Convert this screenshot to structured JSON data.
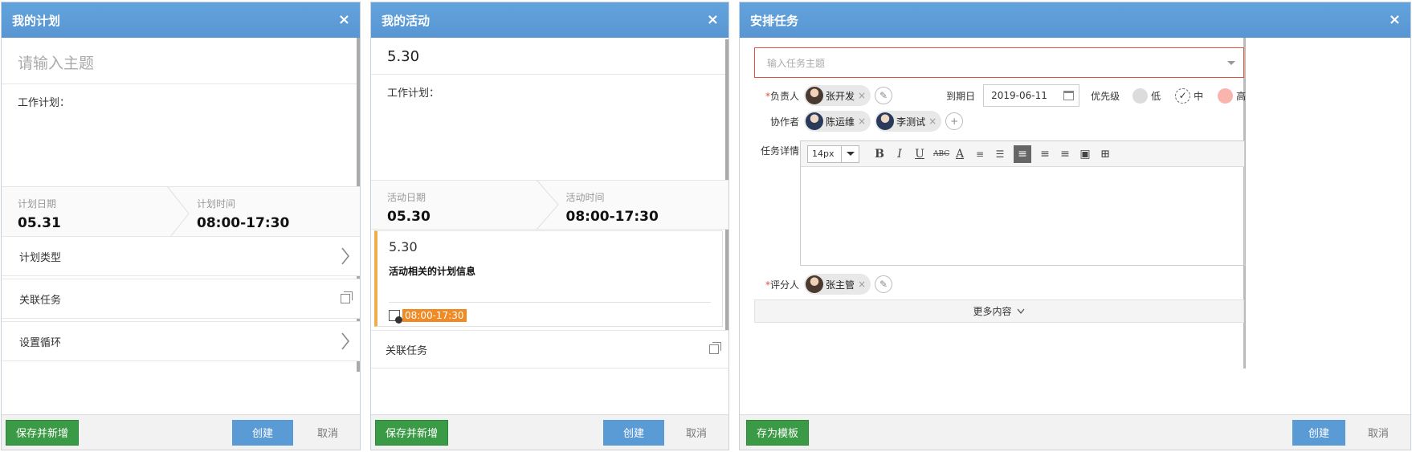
{
  "panel1": {
    "title": "我的计划",
    "close": "×",
    "subject_placeholder": "请输入主题",
    "body_label": "工作计划：",
    "date_label": "计划日期",
    "date_value": "05.31",
    "time_label": "计划时间",
    "time_value": "08:00-17:30",
    "rows": [
      "计划类型",
      "关联任务",
      "设置循环"
    ],
    "save_new": "保存并新增",
    "create": "创建",
    "cancel": "取消"
  },
  "panel2": {
    "title": "我的活动",
    "close": "×",
    "subject": "5.30",
    "body_label": "工作计划：",
    "date_label": "活动日期",
    "date_value": "05.30",
    "time_label": "活动时间",
    "time_value": "08:00-17:30",
    "card_title": "5.30",
    "card_desc": "活动相关的计划信息",
    "card_time": "08:00-17:30",
    "related": "关联任务",
    "save_new": "保存并新增",
    "create": "创建",
    "cancel": "取消"
  },
  "panel3": {
    "title": "安排任务",
    "close": "×",
    "subject_placeholder": "输入任务主题",
    "owner_label": "负责人",
    "owner": "张开发",
    "due_label": "到期日",
    "due_value": "2019-06-11",
    "priority_label": "优先级",
    "priority_low": "低",
    "priority_mid": "中",
    "priority_high": "高",
    "collab_label": "协作者",
    "collaborators": [
      "陈运维",
      "李测试"
    ],
    "detail_label": "任务详情",
    "font_size": "14px",
    "reviewer_label": "评分人",
    "reviewer": "张主管",
    "more": "更多内容",
    "save_template": "存为模板",
    "create": "创建",
    "cancel": "取消"
  }
}
